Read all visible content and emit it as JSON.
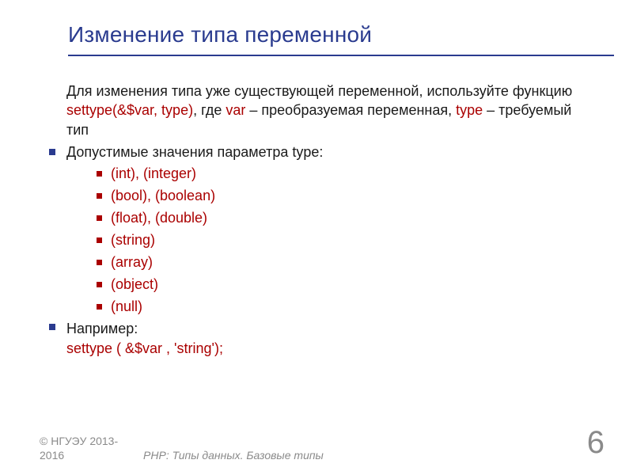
{
  "title": "Изменение типа переменной",
  "intro": {
    "pre": "Для изменения типа уже существующей переменной, используйте функцию ",
    "fn": "settype(&$var, type)",
    "mid1": ", где ",
    "var": "var",
    "mid2": " – преобразуемая переменная, ",
    "type_word": "type",
    "post": " – требуемый тип"
  },
  "param_line": "Допустимые значения параметра type:",
  "types": [
    "(int), (integer)",
    "(bool), (boolean)",
    "(float), (double)",
    "(string)",
    "(array)",
    "(object)",
    "(null)"
  ],
  "example_label": "Например:",
  "example_code": "settype ( &$var , 'string');",
  "footer": {
    "copyright_line1": "© НГУЭУ 2013-",
    "copyright_line2": "2016",
    "subject": "PHP: Типы данных. Базовые типы"
  },
  "page_number": "6"
}
